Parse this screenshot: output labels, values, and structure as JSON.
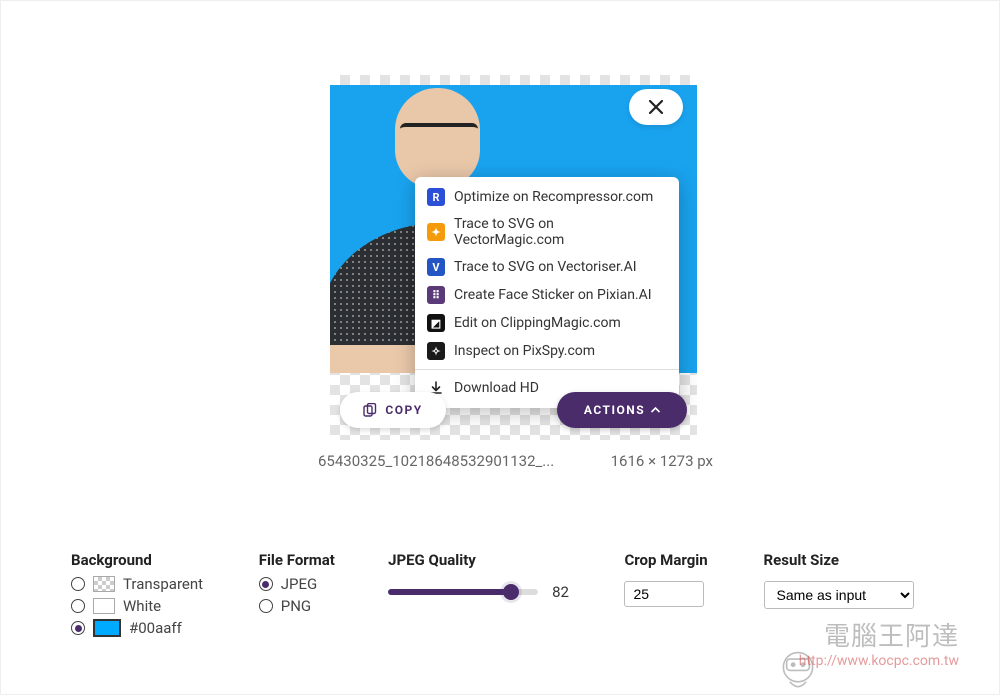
{
  "preview": {
    "filename": "65430325_10218648532901132_...",
    "dimensions": "1616 × 1273 px",
    "copy_label": "COPY",
    "actions_label": "ACTIONS"
  },
  "actions_menu": {
    "items": [
      {
        "label": "Optimize on Recompressor.com",
        "icon": "recompressor-icon",
        "icon_text": "R",
        "icon_class": "ic-blue"
      },
      {
        "label": "Trace to SVG on VectorMagic.com",
        "icon": "vectormagic-icon",
        "icon_text": "✦",
        "icon_class": "ic-orange"
      },
      {
        "label": "Trace to SVG on Vectoriser.AI",
        "icon": "vectoriser-icon",
        "icon_text": "V",
        "icon_class": "ic-bluev"
      },
      {
        "label": "Create Face Sticker on Pixian.AI",
        "icon": "pixian-icon",
        "icon_text": "⠿",
        "icon_class": "ic-purple"
      },
      {
        "label": "Edit on ClippingMagic.com",
        "icon": "clippingmagic-icon",
        "icon_text": "◩",
        "icon_class": "ic-bw"
      },
      {
        "label": "Inspect on PixSpy.com",
        "icon": "pixspy-icon",
        "icon_text": "✧",
        "icon_class": "ic-black"
      }
    ],
    "download_label": "Download HD"
  },
  "settings": {
    "background": {
      "heading": "Background",
      "transparent_label": "Transparent",
      "white_label": "White",
      "color_hex": "#00aaff",
      "selected": "color"
    },
    "file_format": {
      "heading": "File Format",
      "jpeg_label": "JPEG",
      "png_label": "PNG",
      "selected": "jpeg"
    },
    "jpeg_quality": {
      "heading": "JPEG Quality",
      "value": 82,
      "min": 0,
      "max": 100
    },
    "crop_margin": {
      "heading": "Crop Margin",
      "value": "25"
    },
    "result_size": {
      "heading": "Result Size",
      "value": "Same as input"
    }
  },
  "watermark": {
    "main": "電腦王阿達",
    "sub": "http://www.kocpc.com.tw"
  }
}
